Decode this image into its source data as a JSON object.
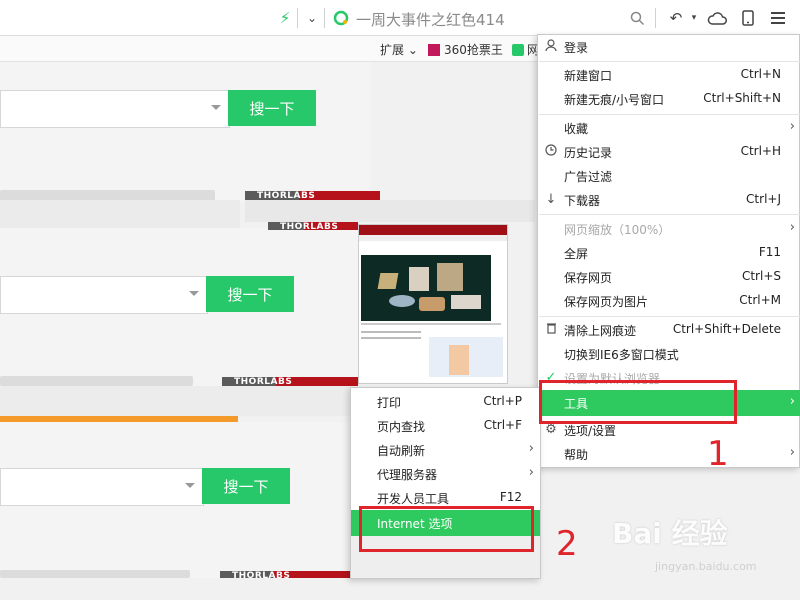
{
  "toolbar": {
    "address_text": "一周大事件之红色414",
    "icons": [
      "lightning-icon",
      "dropdown-icon",
      "browser-logo-icon",
      "search-icon",
      "undo-icon",
      "cloud-icon",
      "mobile-icon",
      "menu-icon"
    ]
  },
  "bookmarks": {
    "items": [
      "扩展",
      "360抢票王",
      "网"
    ]
  },
  "page": {
    "search_button": "搜一下",
    "thorlabs_label": "THORLABS"
  },
  "menu": {
    "items": [
      {
        "label": "登录",
        "shortcut": "",
        "icon": "person-icon"
      },
      {
        "label": "新建窗口",
        "shortcut": "Ctrl+N"
      },
      {
        "label": "新建无痕/小号窗口",
        "shortcut": "Ctrl+Shift+N"
      },
      {
        "label": "收藏",
        "shortcut": "",
        "submenu": true
      },
      {
        "label": "历史记录",
        "shortcut": "Ctrl+H",
        "icon": "clock-icon"
      },
      {
        "label": "广告过滤",
        "shortcut": ""
      },
      {
        "label": "下载器",
        "shortcut": "Ctrl+J",
        "icon": "download-icon"
      },
      {
        "label": "网页缩放（100%）",
        "shortcut": "",
        "submenu": true,
        "disabled": true
      },
      {
        "label": "全屏",
        "shortcut": "F11"
      },
      {
        "label": "保存网页",
        "shortcut": "Ctrl+S"
      },
      {
        "label": "保存网页为图片",
        "shortcut": "Ctrl+M"
      },
      {
        "label": "清除上网痕迹",
        "shortcut": "Ctrl+Shift+Delete",
        "icon": "trash-icon"
      },
      {
        "label": "切换到IE6多窗口模式",
        "shortcut": ""
      },
      {
        "label": "设置为默认浏览器",
        "shortcut": "",
        "icon": "check-icon",
        "disabled": true
      },
      {
        "label": "工具",
        "shortcut": "",
        "submenu": true,
        "highlighted": true
      },
      {
        "label": "选项/设置",
        "shortcut": "",
        "icon": "gear-icon"
      },
      {
        "label": "帮助",
        "shortcut": "",
        "submenu": true
      }
    ]
  },
  "submenu": {
    "items": [
      {
        "label": "打印",
        "shortcut": "Ctrl+P"
      },
      {
        "label": "页内查找",
        "shortcut": "Ctrl+F"
      },
      {
        "label": "自动刷新",
        "shortcut": "",
        "submenu": true
      },
      {
        "label": "代理服务器",
        "shortcut": "",
        "submenu": true
      },
      {
        "label": "开发人员工具",
        "shortcut": "F12"
      },
      {
        "label": "Internet 选项",
        "shortcut": "",
        "highlighted": true
      }
    ]
  },
  "annotations": {
    "step1": "1",
    "step2": "2"
  },
  "watermark": {
    "logo": "Bai 经验",
    "url": "jingyan.baidu.com"
  },
  "colors": {
    "accent_green": "#2fca5f",
    "annotation_red": "#e0242b"
  }
}
